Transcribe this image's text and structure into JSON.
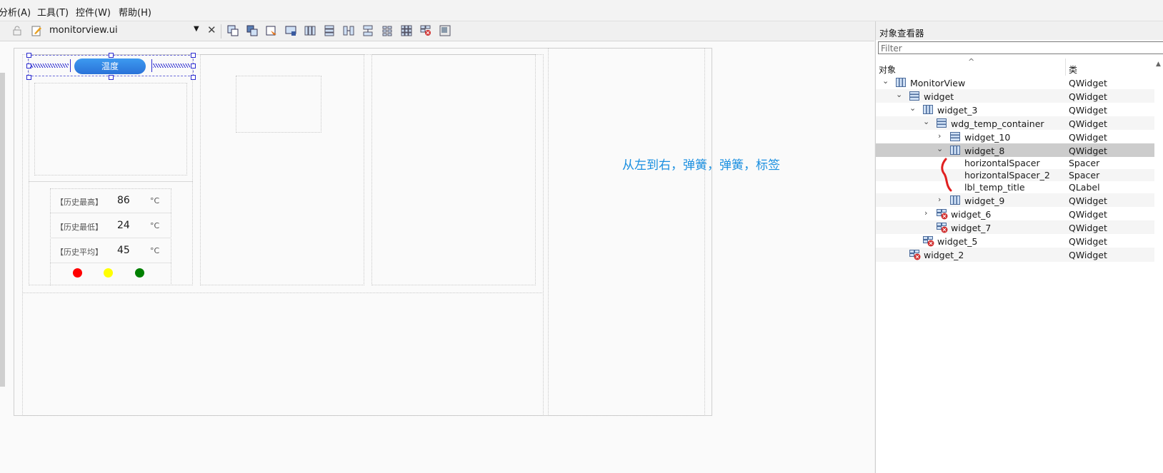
{
  "menu": [
    "分析(A)",
    "工具(T)",
    "控件(W)",
    "帮助(H)"
  ],
  "tab": {
    "filename": "monitorview.ui"
  },
  "form": {
    "title_button": "温度",
    "stats": [
      {
        "label": "【历史最高】",
        "value": "86",
        "unit": "°C"
      },
      {
        "label": "【历史最低】",
        "value": "24",
        "unit": "°C"
      },
      {
        "label": "【历史平均】",
        "value": "45",
        "unit": "°C"
      }
    ],
    "indicator_colors": [
      "#ff0000",
      "#ffff00",
      "#008000"
    ],
    "annotation": "从左到右，弹簧，弹簧，标签"
  },
  "inspector": {
    "title": "对象查看器",
    "filter_placeholder": "Filter",
    "col_object": "对象",
    "col_class": "类",
    "rows": [
      {
        "name": "MonitorView",
        "cls": "QWidget"
      },
      {
        "name": "widget",
        "cls": "QWidget"
      },
      {
        "name": "widget_3",
        "cls": "QWidget"
      },
      {
        "name": "wdg_temp_container",
        "cls": "QWidget"
      },
      {
        "name": "widget_10",
        "cls": "QWidget"
      },
      {
        "name": "widget_8",
        "cls": "QWidget"
      },
      {
        "name": "horizontalSpacer",
        "cls": "Spacer"
      },
      {
        "name": "horizontalSpacer_2",
        "cls": "Spacer"
      },
      {
        "name": "lbl_temp_title",
        "cls": "QLabel"
      },
      {
        "name": "widget_9",
        "cls": "QWidget"
      },
      {
        "name": "widget_6",
        "cls": "QWidget"
      },
      {
        "name": "widget_7",
        "cls": "QWidget"
      },
      {
        "name": "widget_5",
        "cls": "QWidget"
      },
      {
        "name": "widget_2",
        "cls": "QWidget"
      }
    ]
  },
  "colors": {
    "accent": "#1a8fe0",
    "selection": "#cce4f7",
    "handle": "#2b2bd0"
  }
}
